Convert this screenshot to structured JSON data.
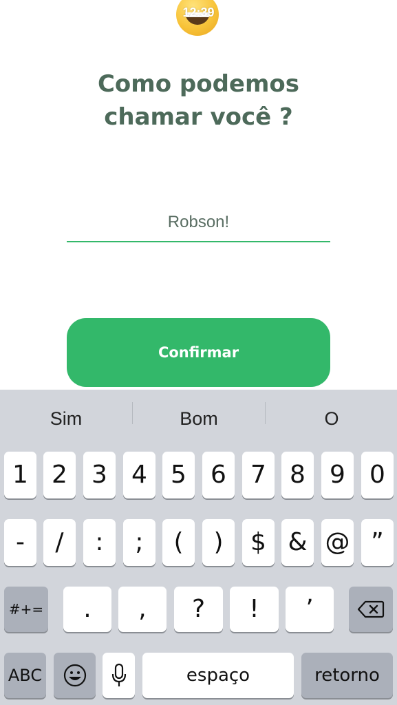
{
  "status": {
    "time": "12:39"
  },
  "header": {
    "emoji": "grinning-face-emoji",
    "title_line1": "Como podemos",
    "title_line2": "chamar você ?"
  },
  "form": {
    "name_value": "Robson!",
    "confirm_label": "Confirmar"
  },
  "colors": {
    "title": "#4d6a5a",
    "accent": "#33b86a",
    "keyboard_bg": "#d2d5db"
  },
  "keyboard": {
    "suggestions": [
      "Sim",
      "Bom",
      "O"
    ],
    "row1": [
      "1",
      "2",
      "3",
      "4",
      "5",
      "6",
      "7",
      "8",
      "9",
      "0"
    ],
    "row2": [
      "-",
      "/",
      ":",
      ";",
      "(",
      ")",
      "$",
      "&",
      "@",
      "”"
    ],
    "row3": {
      "shift_label": "#+=",
      "keys": [
        ".",
        ",",
        "?",
        "!",
        "’"
      ],
      "backspace_icon": "backspace-icon"
    },
    "row4": {
      "abc_label": "ABC",
      "emoji_icon": "emoji-icon",
      "mic_icon": "microphone-icon",
      "space_label": "espaço",
      "return_label": "retorno"
    }
  }
}
